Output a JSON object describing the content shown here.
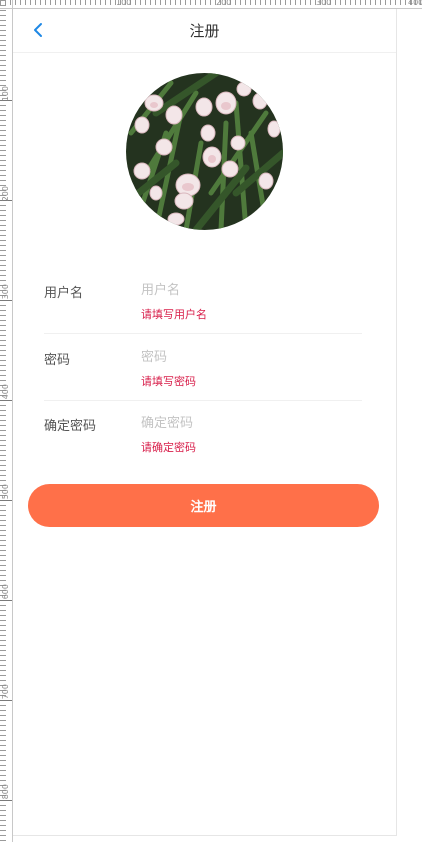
{
  "header": {
    "title": "注册",
    "back_icon": "chevron-left-icon"
  },
  "avatar": {
    "icon": "avatar-photo"
  },
  "form": {
    "username": {
      "label": "用户名",
      "placeholder": "用户名",
      "value": "",
      "error": "请填写用户名"
    },
    "password": {
      "label": "密码",
      "placeholder": "密码",
      "value": "",
      "error": "请填写密码"
    },
    "confirm_password": {
      "label": "确定密码",
      "placeholder": "确定密码",
      "value": "",
      "error": "请确定密码"
    },
    "submit_label": "注册"
  },
  "colors": {
    "accent": "#ff7049",
    "error": "#d81e4a",
    "back_icon": "#1e88e5"
  },
  "ruler": {
    "left_labels": [
      "100",
      "200",
      "300",
      "400",
      "500",
      "600",
      "700",
      "800"
    ],
    "top_labels": [
      "100",
      "200",
      "300",
      "400"
    ]
  }
}
